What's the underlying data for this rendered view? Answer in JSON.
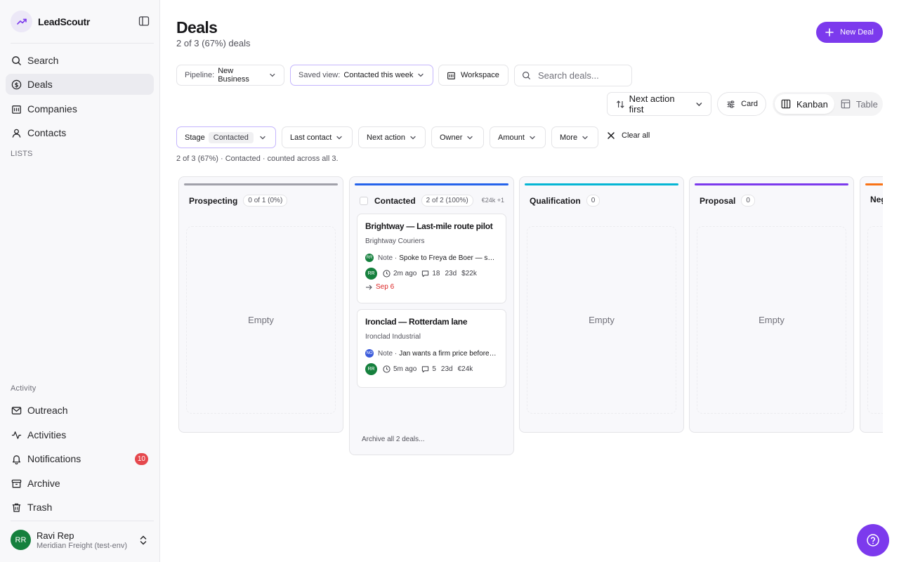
{
  "app": {
    "name": "LeadScoutr"
  },
  "sidebar": {
    "nav": [
      {
        "label": "Search",
        "icon": "search-icon"
      },
      {
        "label": "Deals",
        "icon": "dollar-circle-icon",
        "active": true
      },
      {
        "label": "Companies",
        "icon": "building-icon"
      },
      {
        "label": "Contacts",
        "icon": "user-icon"
      }
    ],
    "lists_label": "LISTS",
    "activity_label": "Activity",
    "activity": [
      {
        "label": "Outreach",
        "icon": "mail-icon"
      },
      {
        "label": "Activities",
        "icon": "activity-icon"
      },
      {
        "label": "Notifications",
        "icon": "bell-icon",
        "badge": "10"
      },
      {
        "label": "Archive",
        "icon": "archive-icon"
      },
      {
        "label": "Trash",
        "icon": "trash-icon"
      }
    ],
    "user": {
      "initials": "RR",
      "name": "Ravi Rep",
      "org": "Meridian Freight (test-env)"
    }
  },
  "header": {
    "title": "Deals",
    "subtitle": "2 of 3 (67%) deals",
    "new_deal": "New Deal"
  },
  "toolbar": {
    "pipeline_label": "Pipeline:",
    "pipeline_value": "New Business",
    "saved_view_label": "Saved view:",
    "saved_view_value": "Contacted this week",
    "workspace": "Workspace",
    "search_placeholder": "Search deals...",
    "sort": "Next action first",
    "card": "Card",
    "view_kanban": "Kanban",
    "view_table": "Table"
  },
  "filters": {
    "stage_label": "Stage",
    "stage_value": "Contacted",
    "last_contact": "Last contact",
    "next_action": "Next action",
    "owner": "Owner",
    "amount": "Amount",
    "more": "More",
    "clear_all": "Clear all",
    "summary": "2 of 3 (67%) · Contacted · counted across all 3."
  },
  "colors": {
    "accent": "#7c3aed",
    "prospecting": "#a1a1aa",
    "contacted": "#2563eb",
    "qualification": "#06b6d4",
    "proposal": "#7c3aed",
    "negotiation": "#f97316",
    "badge": "#e5484d",
    "avatar_rr": "#15803d",
    "avatar_no": "#3b5bdb"
  },
  "columns": [
    {
      "name": "Prospecting",
      "count": "0 of 1 (0%)",
      "empty": "Empty"
    },
    {
      "name": "Contacted",
      "count": "2 of 2 (100%)",
      "amount": "€24k +1",
      "cards": [
        {
          "title": "Brightway — Last-mile route pilot",
          "company": "Brightway Couriers",
          "note_initials": "RR",
          "note_label": "Note ·",
          "note_text": "Spoke to Freya de Boer — she wants a proposal",
          "owner": "RR",
          "time": "2m ago",
          "comments": "18",
          "age": "23d",
          "amount": "$22k",
          "next_date": "Sep 6"
        },
        {
          "title": "Ironclad — Rotterdam lane",
          "company": "Ironclad Industrial",
          "note_initials": "NO",
          "note_label": "Note ·",
          "note_text": "Jan wants a firm price before Friday",
          "owner": "RR",
          "time": "5m ago",
          "comments": "5",
          "age": "23d",
          "amount": "€24k"
        }
      ],
      "archive": "Archive all 2 deals..."
    },
    {
      "name": "Qualification",
      "count": "0",
      "empty": "Empty"
    },
    {
      "name": "Proposal",
      "count": "0",
      "empty": "Empty"
    },
    {
      "name": "Negotiation"
    }
  ]
}
